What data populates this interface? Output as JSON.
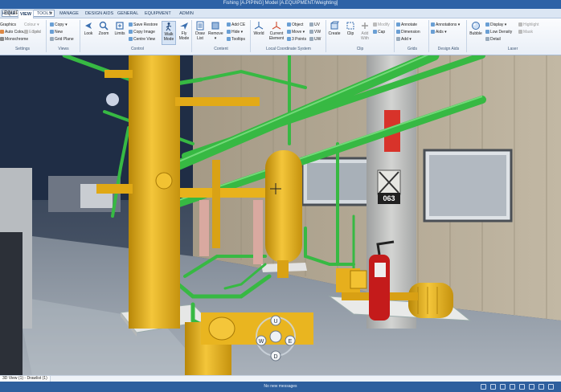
{
  "window": {
    "title": "Fishing [A.PIPING] Model [A.EQUIPMENT/Weighting]"
  },
  "project_selector": {
    "value": "EQUIPMENT"
  },
  "tabs": [
    "HOME",
    "VIEW",
    "TOOLS",
    "MANAGE",
    "DESIGN AIDS",
    "GENERAL",
    "EQUIPMENT",
    "ADMIN"
  ],
  "active_tab": "VIEW",
  "ribbon": {
    "settings": {
      "label": "Settings",
      "items": [
        "Graphics",
        "Auto Colour",
        "Monochrome",
        "Colour",
        "Edges",
        "Solid"
      ]
    },
    "views": {
      "label": "Views",
      "items": [
        "Copy",
        "New",
        "Grid Plane"
      ]
    },
    "control": {
      "label": "Control",
      "buttons": [
        "Look",
        "Zoom",
        "Limits",
        "Walk Mode",
        "Fly Mode"
      ],
      "items": [
        "Save Restore",
        "Copy Image",
        "Centre View"
      ]
    },
    "content": {
      "label": "Content",
      "buttons": [
        "Draw List",
        "Remove"
      ],
      "items": [
        "Add CE",
        "Hide",
        "Tooltips"
      ]
    },
    "lcs": {
      "label": "Local Coordinate System",
      "buttons": [
        "World",
        "Current Element"
      ],
      "items": [
        "Object",
        "Move",
        "3 Points",
        "UV",
        "VW",
        "UW"
      ]
    },
    "clip": {
      "label": "Clip",
      "buttons": [
        "Create",
        "Clip",
        "Add With"
      ],
      "items": [
        "Modify",
        "Cap"
      ]
    },
    "grids": {
      "label": "Grids",
      "items": [
        "Annotate",
        "Dimension",
        "Add"
      ]
    },
    "design_aids": {
      "label": "Design Aids",
      "items": [
        "Annotations",
        "Aids"
      ]
    },
    "laser": {
      "label": "Laser",
      "buttons": [
        "Bubble"
      ],
      "items": [
        "Display",
        "Low Density",
        "Detail",
        "Highlight",
        "Mask"
      ]
    }
  },
  "viewport": {
    "sign_number": "063",
    "compass_labels": [
      "U",
      "W",
      "E",
      "D"
    ]
  },
  "document_tab": "3D View (1) - Drawlist (1)",
  "status": {
    "message": "No new messages"
  },
  "colors": {
    "title_bar": "#2d62a6",
    "pipe_green": "#3ec64a",
    "pipe_yellow": "#e8b21c",
    "status_bar": "#2e5f9e"
  }
}
